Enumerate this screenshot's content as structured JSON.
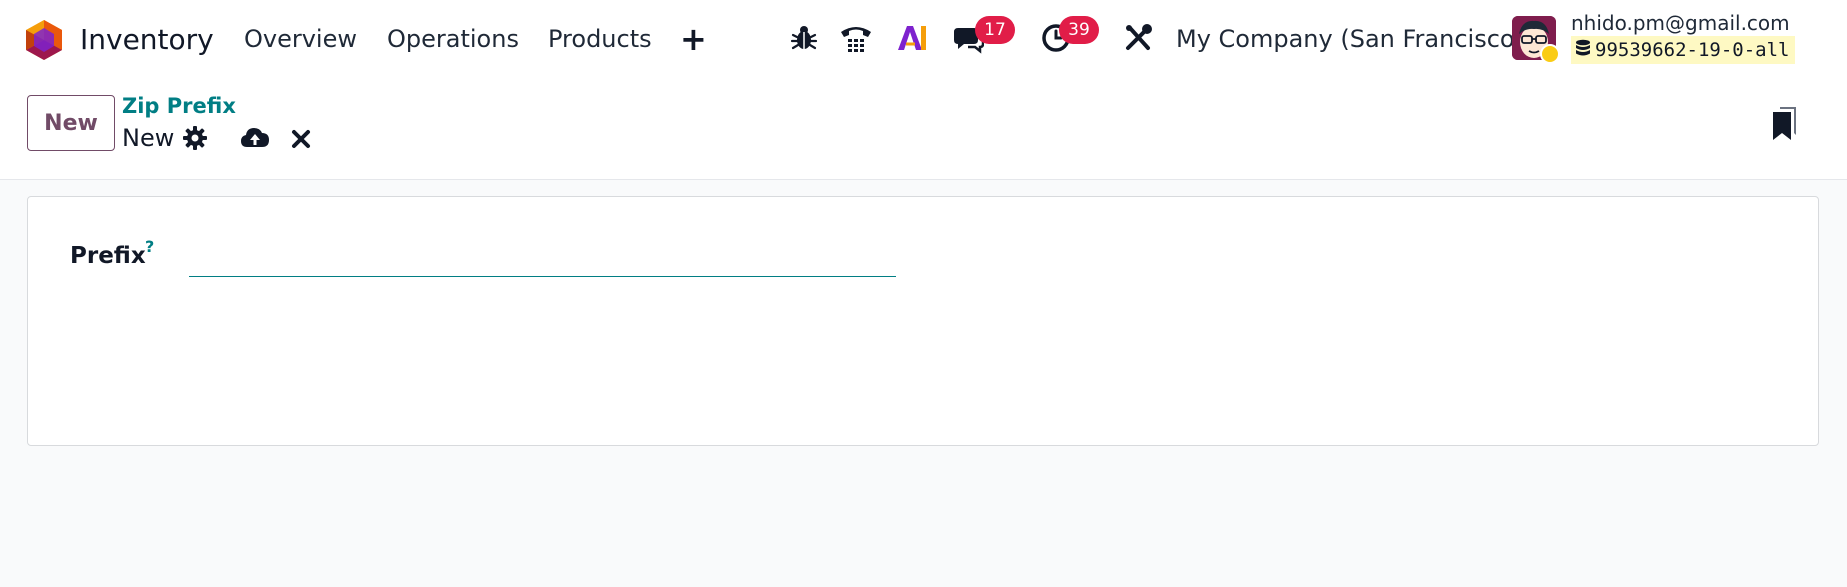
{
  "navbar": {
    "app_name": "Inventory",
    "menu": [
      {
        "label": "Overview"
      },
      {
        "label": "Operations"
      },
      {
        "label": "Products"
      }
    ],
    "plus_label": "+",
    "messages_badge": "17",
    "activities_badge": "39",
    "company": "My Company (San Francisco)",
    "user_email": "nhido.pm@gmail.com",
    "database": "99539662-19-0-all",
    "icons": [
      "app-logo-icon",
      "bug-icon",
      "phone-icon",
      "ai-icon",
      "chat-icon",
      "clock-icon",
      "tools-icon",
      "database-icon"
    ]
  },
  "control_panel": {
    "new_button": "New",
    "breadcrumb_parent": "Zip Prefix",
    "record_name": "New",
    "icons": [
      "gear-icon",
      "cloud-upload-icon",
      "close-icon",
      "bookmark-icon"
    ]
  },
  "form": {
    "prefix_label": "Prefix",
    "prefix_help": "?",
    "prefix_value": ""
  },
  "colors": {
    "brand": "#714b67",
    "accent": "#017e84",
    "badge": "#e11d48",
    "db_chip": "#fef9c3"
  }
}
